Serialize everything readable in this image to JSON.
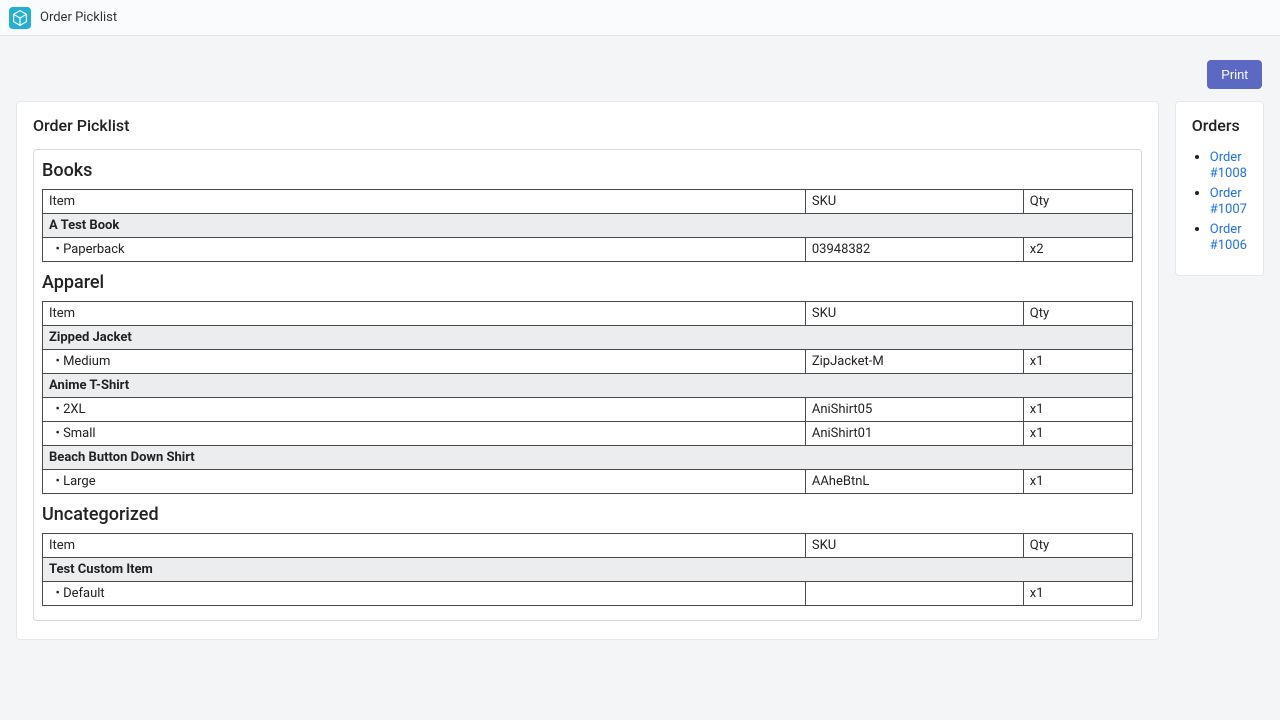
{
  "header": {
    "title": "Order Picklist"
  },
  "actions": {
    "print_label": "Print"
  },
  "picklist": {
    "title": "Order Picklist",
    "columns": {
      "item": "Item",
      "sku": "SKU",
      "qty": "Qty"
    },
    "sections": [
      {
        "title": "Books",
        "products": [
          {
            "name": "A Test Book",
            "variants": [
              {
                "name": "Paperback",
                "sku": "03948382",
                "qty": "x2"
              }
            ]
          }
        ]
      },
      {
        "title": "Apparel",
        "products": [
          {
            "name": "Zipped Jacket",
            "variants": [
              {
                "name": "Medium",
                "sku": "ZipJacket-M",
                "qty": "x1"
              }
            ]
          },
          {
            "name": "Anime T-Shirt",
            "variants": [
              {
                "name": "2XL",
                "sku": "AniShirt05",
                "qty": "x1"
              },
              {
                "name": "Small",
                "sku": "AniShirt01",
                "qty": "x1"
              }
            ]
          },
          {
            "name": "Beach Button Down Shirt",
            "variants": [
              {
                "name": "Large",
                "sku": "AAheBtnL",
                "qty": "x1"
              }
            ]
          }
        ]
      },
      {
        "title": "Uncategorized",
        "products": [
          {
            "name": "Test Custom Item",
            "variants": [
              {
                "name": "Default",
                "sku": "",
                "qty": "x1"
              }
            ]
          }
        ]
      }
    ]
  },
  "orders": {
    "title": "Orders",
    "items": [
      {
        "label": "Order #1008"
      },
      {
        "label": "Order #1007"
      },
      {
        "label": "Order #1006"
      }
    ]
  }
}
